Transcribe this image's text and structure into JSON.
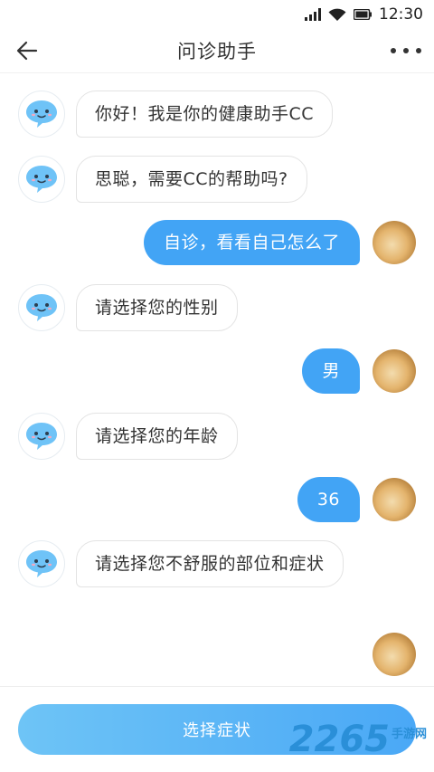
{
  "status_bar": {
    "time": "12:30",
    "signal_icon": "signal-icon",
    "wifi_icon": "wifi-icon",
    "battery_icon": "battery-icon"
  },
  "nav": {
    "title": "问诊助手",
    "back_icon": "arrow-left-icon",
    "more_icon": "more-dots-icon"
  },
  "messages": [
    {
      "side": "bot",
      "text": "你好！我是你的健康助手CC"
    },
    {
      "side": "bot",
      "text": "思聪，需要CC的帮助吗?"
    },
    {
      "side": "user",
      "text": "自诊，看看自己怎么了"
    },
    {
      "side": "bot",
      "text": "请选择您的性别"
    },
    {
      "side": "user",
      "text": "男"
    },
    {
      "side": "bot",
      "text": "请选择您的年龄"
    },
    {
      "side": "user",
      "text": "36"
    },
    {
      "side": "bot",
      "text": "请选择您不舒服的部位和症状"
    }
  ],
  "bottom": {
    "button_label": "选择症状"
  },
  "watermark": {
    "number": "2265",
    "text": "手游网"
  },
  "colors": {
    "accent": "#42a4f5",
    "bot_bubble_border": "#e3e3e3",
    "bot_icon": "#6fc3f7"
  }
}
